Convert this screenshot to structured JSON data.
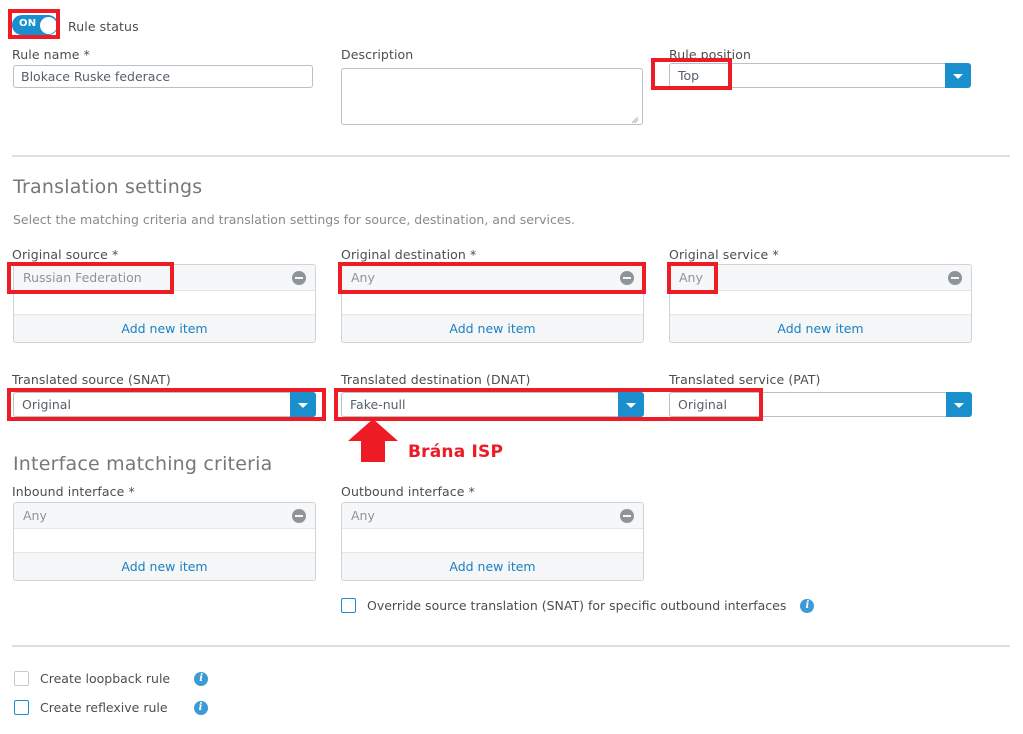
{
  "rule_status": {
    "toggle_state": "ON",
    "label": "Rule status"
  },
  "basic": {
    "rule_name_label": "Rule name *",
    "rule_name_value": "Blokace Ruske federace",
    "description_label": "Description",
    "description_value": "",
    "rule_position_label": "Rule position",
    "rule_position_value": "Top"
  },
  "translation": {
    "title": "Translation settings",
    "subtitle": "Select the matching criteria and translation settings for source, destination, and services.",
    "original_source": {
      "label": "Original source *",
      "items": [
        "Russian Federation"
      ],
      "add_new": "Add new item"
    },
    "original_destination": {
      "label": "Original destination *",
      "items": [
        "Any"
      ],
      "add_new": "Add new item"
    },
    "original_service": {
      "label": "Original service *",
      "items": [
        "Any"
      ],
      "add_new": "Add new item"
    },
    "translated_source": {
      "label": "Translated source (SNAT)",
      "value": "Original"
    },
    "translated_destination": {
      "label": "Translated destination (DNAT)",
      "value": "Fake-null"
    },
    "translated_service": {
      "label": "Translated service (PAT)",
      "value": "Original"
    }
  },
  "interface": {
    "title": "Interface matching criteria",
    "inbound": {
      "label": "Inbound interface *",
      "items": [
        "Any"
      ],
      "add_new": "Add new item"
    },
    "outbound": {
      "label": "Outbound interface *",
      "items": [
        "Any"
      ],
      "add_new": "Add new item"
    },
    "override": {
      "label": "Override source translation (SNAT) for specific outbound interfaces",
      "checked": false,
      "info": "i"
    }
  },
  "footer": {
    "loopback": {
      "label": "Create loopback rule",
      "checked": false,
      "info": "i"
    },
    "reflexive": {
      "label": "Create reflexive rule",
      "checked": false,
      "info": "i"
    }
  },
  "annotation": {
    "callout_text": "Brána ISP",
    "accent_color": "#ec1b24"
  },
  "icons": {
    "minus": "remove-item-icon",
    "dropdown": "chevron-down-icon",
    "info": "info-icon"
  }
}
